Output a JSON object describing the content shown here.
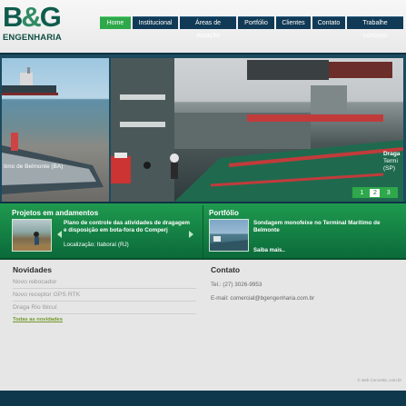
{
  "brand": {
    "logo_big_b": "B",
    "logo_amp": "&",
    "logo_big_g": "G",
    "logo_sub": "ENGENHARIA"
  },
  "nav": {
    "items": [
      "Home",
      "Institucional",
      "Áreas de Atuação",
      "Portfólio",
      "Clientes",
      "Contato",
      "Trabalhe conosco"
    ],
    "active": "Home"
  },
  "banner": {
    "caption_left": "timo de Belmonte (BA)",
    "caption_right_1": "Draga",
    "caption_right_2": "Termi",
    "caption_right_3": "(SP)",
    "pages": [
      "1",
      "2",
      "3"
    ],
    "active_page": "2"
  },
  "projetos": {
    "title": "Projetos em andamentos",
    "text": "Plano de controle das atividades de dragagem e disposição em bota-fora do Comperj",
    "location": "Localização: Itaboraí (RJ)"
  },
  "portfolio": {
    "title": "Portfólio",
    "text": "Sondagem monofeixe no Terminal Marítimo de Belmonte",
    "more": "Saiba mais.."
  },
  "novidades": {
    "title": "Novidades",
    "items": [
      "Novo rebocador",
      "Novo receptor GPS RTK",
      "Draga Rio Ibicuí"
    ],
    "all_link": "Todas as novidades"
  },
  "contato": {
    "title": "Contato",
    "phone": "Tel.: (27) 3026-9953",
    "email": "E-mail: comercial@bgengenharia.com.br"
  },
  "footer": {
    "credit": "© web Concreta .com.br"
  },
  "colors": {
    "nav_bg": "#113a56",
    "nav_active": "#2ea84a",
    "band": "#1f9a4f",
    "footer": "#10384d"
  }
}
